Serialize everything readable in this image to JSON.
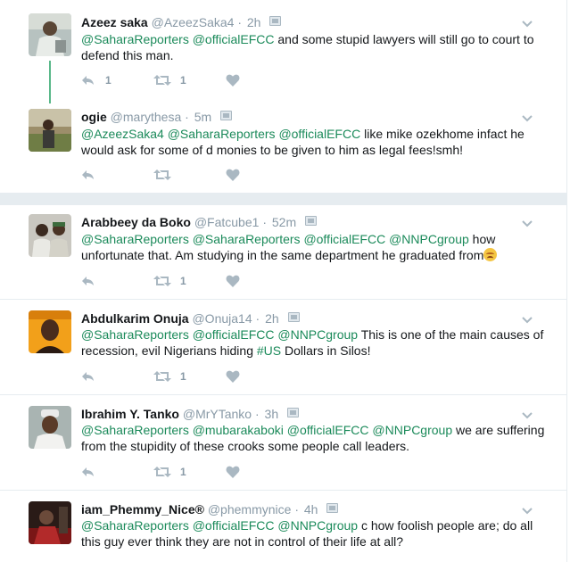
{
  "tweets": [
    {
      "name": "Azeez saka",
      "handle": "@AzeezSaka4",
      "time": "2h",
      "parts": [
        {
          "t": "@SaharaReporters",
          "link": true
        },
        {
          "t": " ",
          "link": false
        },
        {
          "t": "@officialEFCC",
          "link": true
        },
        {
          "t": " and some stupid lawyers will still go to court to defend this man.",
          "link": false
        }
      ],
      "reply_count": "1",
      "retweet_count": "1",
      "like_count": ""
    },
    {
      "name": "ogie",
      "handle": "@marythesa",
      "time": "5m",
      "parts": [
        {
          "t": "@AzeezSaka4",
          "link": true
        },
        {
          "t": " ",
          "link": false
        },
        {
          "t": "@SaharaReporters",
          "link": true
        },
        {
          "t": " ",
          "link": false
        },
        {
          "t": "@officialEFCC",
          "link": true
        },
        {
          "t": " like mike ozekhome infact he would ask for some of d monies to be given to him as legal fees!smh!",
          "link": false
        }
      ],
      "reply_count": "",
      "retweet_count": "",
      "like_count": ""
    },
    {
      "name": "Arabbeey da Boko",
      "handle": "@Fatcube1",
      "time": "52m",
      "parts": [
        {
          "t": "@SaharaReporters",
          "link": true
        },
        {
          "t": " ",
          "link": false
        },
        {
          "t": "@SaharaReporters",
          "link": true
        },
        {
          "t": " ",
          "link": false
        },
        {
          "t": "@officialEFCC",
          "link": true
        },
        {
          "t": " ",
          "link": false
        },
        {
          "t": "@NNPCgroup",
          "link": true
        },
        {
          "t": " how unfortunate that. Am studying in the same department he graduated from",
          "link": false
        }
      ],
      "emoji": "persevering-face",
      "reply_count": "",
      "retweet_count": "1",
      "like_count": ""
    },
    {
      "name": "Abdulkarim Onuja",
      "handle": "@Onuja14",
      "time": "2h",
      "parts": [
        {
          "t": "@SaharaReporters",
          "link": true
        },
        {
          "t": " ",
          "link": false
        },
        {
          "t": "@officialEFCC",
          "link": true
        },
        {
          "t": " ",
          "link": false
        },
        {
          "t": "@NNPCgroup",
          "link": true
        },
        {
          "t": " This is one of the main causes of recession, evil Nigerians hiding ",
          "link": false
        },
        {
          "t": "#US",
          "link": true
        },
        {
          "t": " Dollars in Silos!",
          "link": false
        }
      ],
      "reply_count": "",
      "retweet_count": "1",
      "like_count": ""
    },
    {
      "name": "Ibrahim Y. Tanko",
      "handle": "@MrYTanko",
      "time": "3h",
      "parts": [
        {
          "t": "@SaharaReporters",
          "link": true
        },
        {
          "t": " ",
          "link": false
        },
        {
          "t": "@mubarakaboki",
          "link": true
        },
        {
          "t": " ",
          "link": false
        },
        {
          "t": "@officialEFCC",
          "link": true
        },
        {
          "t": " ",
          "link": false
        },
        {
          "t": "@NNPCgroup",
          "link": true
        },
        {
          "t": " we are suffering from the stupidity of these crooks some people call leaders.",
          "link": false
        }
      ],
      "reply_count": "",
      "retweet_count": "1",
      "like_count": ""
    },
    {
      "name": "iam_Phemmy_Nice®",
      "handle": "@phemmynice",
      "time": "4h",
      "parts": [
        {
          "t": "@SaharaReporters",
          "link": true
        },
        {
          "t": " ",
          "link": false
        },
        {
          "t": "@officialEFCC",
          "link": true
        },
        {
          "t": " ",
          "link": false
        },
        {
          "t": "@NNPCgroup",
          "link": true
        },
        {
          "t": " c how foolish people are; do all this guy ever think they are not in control of their life at all?",
          "link": false
        }
      ],
      "reply_count": "",
      "retweet_count": "",
      "like_count": ""
    }
  ],
  "separator": "·",
  "colors": {
    "link": "#1b8a5a",
    "muted": "#8899a6",
    "thread_line": "#5ab88a",
    "divider": "#e6ecf0"
  },
  "icons": {
    "reply": "reply-icon",
    "retweet": "retweet-icon",
    "like": "heart-icon",
    "caret": "chevron-down-icon",
    "location": "geo-icon"
  }
}
